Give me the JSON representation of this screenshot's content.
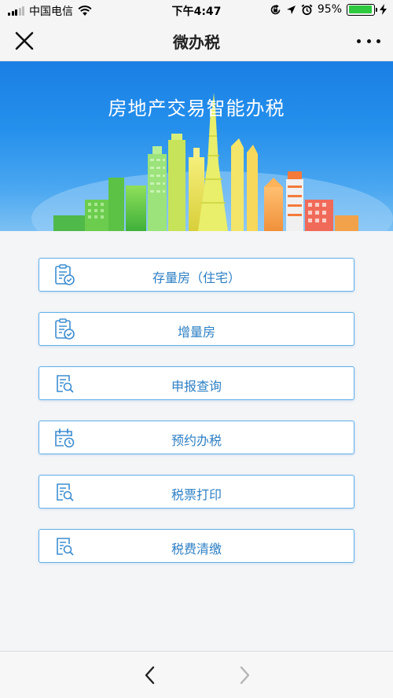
{
  "status_bar": {
    "carrier": "中国电信",
    "time": "下午4:47",
    "battery_percent": "95%",
    "battery_level": 0.95,
    "icons": [
      "signal-icon",
      "wifi-icon",
      "screen-lock-icon",
      "location-arrow-icon",
      "alarm-icon",
      "battery-icon",
      "charging-icon"
    ]
  },
  "nav": {
    "title": "微办税",
    "close_icon": "close-icon",
    "more_icon": "more-dots-icon"
  },
  "banner": {
    "title": "房地产交易智能办税",
    "colors": {
      "sky_top": "#1a7fe4",
      "sky_bottom": "#7cc0f3"
    }
  },
  "menu": {
    "accent_color": "#5fb0ec",
    "label_color": "#2d7fc4",
    "items": [
      {
        "label": "存量房（住宅）",
        "icon": "clipboard-check-icon"
      },
      {
        "label": "增量房",
        "icon": "clipboard-check-icon"
      },
      {
        "label": "申报查询",
        "icon": "document-search-icon"
      },
      {
        "label": "预约办税",
        "icon": "calendar-clock-icon"
      },
      {
        "label": "税票打印",
        "icon": "document-search-icon"
      },
      {
        "label": "税费清缴",
        "icon": "document-search-icon"
      }
    ]
  },
  "toolbar": {
    "back_icon": "chevron-left-icon",
    "forward_icon": "chevron-right-icon"
  }
}
